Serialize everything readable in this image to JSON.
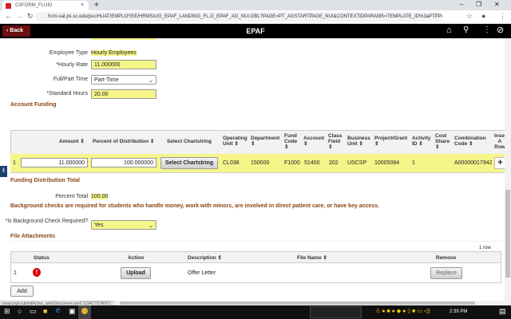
{
  "browser": {
    "tab_title": "G3FORM_FLUID",
    "url": "hcm-uat.ps.sc.edu/psc/HUAT/EMPLOYEE/HRMS/c/G_EPAF_LANDING_FL.G_EPAF_AG_NUI.GBL?PAGE=PT_AGSTARTPAGE_NUI&CONTEXTIDPARAMS=TEMPLATE_ID%3aPTPPNAVCOL&sa=n&scn..."
  },
  "header": {
    "back_label": "Back",
    "title": "EPAF"
  },
  "form": {
    "employee_type_label": "Employee Type",
    "employee_type_value": "Hourly Employees",
    "hourly_rate_label": "*Hourly Rate",
    "hourly_rate_value": "11.000000",
    "full_part_label": "Full/Part Time",
    "full_part_value": "Part-Time",
    "std_hours_label": "*Standard Hours",
    "std_hours_value": "20.00"
  },
  "funding": {
    "title": "Account Funding",
    "columns": [
      "Amount ⇕",
      "Percent of Distribution ⇕",
      "Select Chartstring",
      "Operating Unit ⇕",
      "Department ⇕",
      "Fund Code ⇕",
      "Account ⇕",
      "Class Field ⇕",
      "Business Unit ⇕",
      "Project/Grant ⇕",
      "Activity ID ⇕",
      "Cost Share ⇕",
      "Combination Code ⇕",
      "Insert A Row"
    ],
    "row": {
      "num": "1",
      "amount": "11.000000",
      "percent": "100.000000",
      "button": "Select Chartstring",
      "cells": [
        "CL038",
        "150000",
        "F1000",
        "51400",
        "202",
        "USCSP",
        "10005084",
        "1",
        "",
        "A00000017942"
      ]
    },
    "total_title": "Funding Distribution Total",
    "percent_total_label": "Percent Total",
    "percent_total_value": "100.00"
  },
  "background": {
    "notice": "Background checks are required for students who handle money, work with minors, are involved in direct patient care, or have key access.",
    "label": "*Is Background Check Required?",
    "value": "Yes"
  },
  "attachments": {
    "title": "File Attachments",
    "row_count": "1 row",
    "columns": [
      "Status",
      "Action",
      "Description ⇕",
      "File Name ⇕",
      "Remove"
    ],
    "row": {
      "num": "1",
      "action": "Upload",
      "description": "Offer Letter",
      "file_name": "",
      "remove": "Replace"
    },
    "add_label": "Add"
  },
  "status_bar": "javascript:submitAction_win0(document.win0,'G3ACTION50');",
  "taskbar": {
    "time": "2:39 PM"
  },
  "colors": {
    "accent": "#8b4513",
    "highlight": "#f5f58a",
    "header": "#000000",
    "back": "#6b0f0f"
  }
}
